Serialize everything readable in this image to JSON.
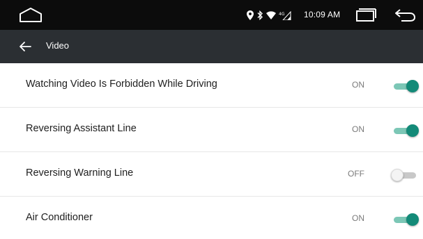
{
  "status_bar": {
    "time": "10:09 AM",
    "icons": [
      "location-icon",
      "bluetooth-icon",
      "wifi-icon",
      "signal-icon"
    ],
    "nav_buttons": [
      "home-icon",
      "recent-apps-icon",
      "back-icon"
    ]
  },
  "title_bar": {
    "title": "Video",
    "back_icon": "arrow-left-icon"
  },
  "settings": [
    {
      "label": "Watching Video Is Forbidden While Driving",
      "state_text": "ON",
      "enabled": true
    },
    {
      "label": "Reversing Assistant Line",
      "state_text": "ON",
      "enabled": true
    },
    {
      "label": "Reversing Warning Line",
      "state_text": "OFF",
      "enabled": false
    },
    {
      "label": "Air Conditioner",
      "state_text": "ON",
      "enabled": true
    }
  ],
  "colors": {
    "status_bar_bg": "#0c0c0c",
    "title_bar_bg": "#2b2f33",
    "toggle_on_thumb": "#138a78",
    "toggle_on_track": "#7cc7b6",
    "toggle_off_track": "#c8c8c8"
  }
}
